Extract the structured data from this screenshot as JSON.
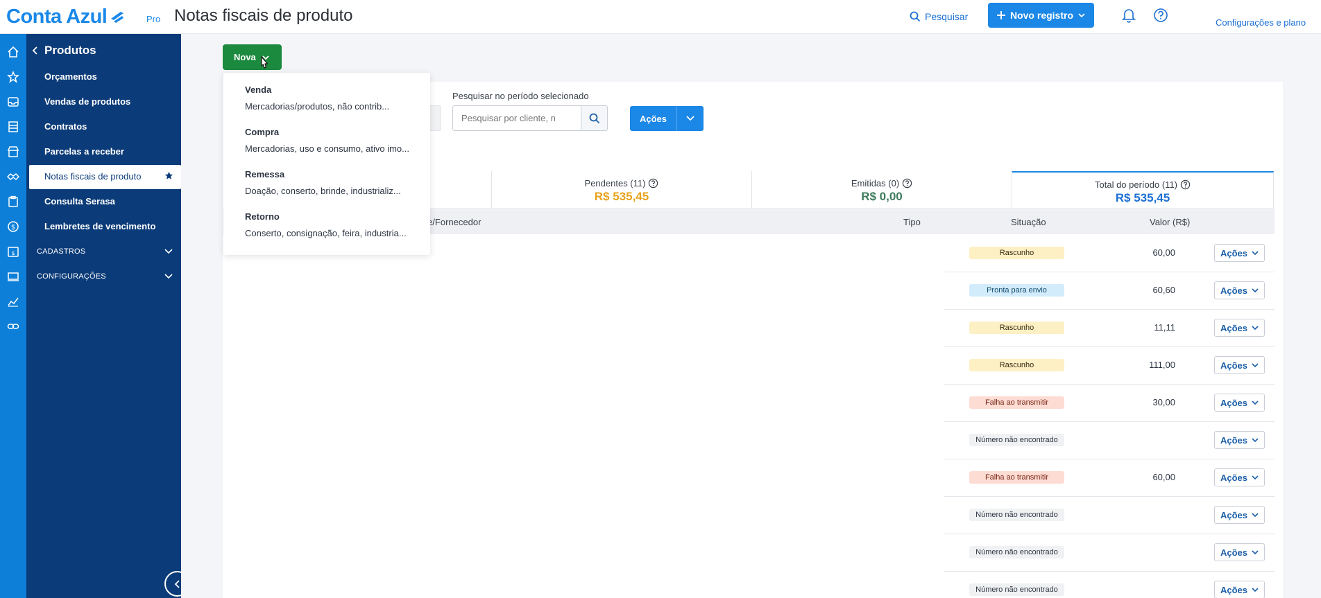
{
  "header": {
    "logo_text": "Conta Azul",
    "logo_badge": "Pro",
    "page_title": "Notas fiscais de produto",
    "search_label": "Pesquisar",
    "new_record_label": "Novo registro",
    "config_label": "Configurações e plano"
  },
  "sidebar": {
    "back_label": "Produtos",
    "items": [
      {
        "label": "Orçamentos"
      },
      {
        "label": "Vendas de produtos"
      },
      {
        "label": "Contratos"
      },
      {
        "label": "Parcelas a receber"
      },
      {
        "label": "Notas fiscais de produto",
        "active": true
      },
      {
        "label": "Consulta Serasa"
      },
      {
        "label": "Lembretes de vencimento"
      }
    ],
    "sections": [
      {
        "label": "CADASTROS"
      },
      {
        "label": "CONFIGURAÇÕES"
      }
    ]
  },
  "toolbar": {
    "nova_label": "Nova",
    "period_label": "Pesquisar no período selecionado",
    "search_placeholder": "Pesquisar por cliente, n",
    "acoes_label": "Ações"
  },
  "dropdown": {
    "items": [
      {
        "title": "Venda",
        "subtitle": "Mercadorias/produtos, não contrib..."
      },
      {
        "title": "Compra",
        "subtitle": "Mercadorias, uso e consumo, ativo imo..."
      },
      {
        "title": "Remessa",
        "subtitle": "Doação, conserto, brinde, industrializ..."
      },
      {
        "title": "Retorno",
        "subtitle": "Conserto, consignação, feira, industria..."
      }
    ]
  },
  "tabs": [
    {
      "label": "Pendentes (11)",
      "value": "R$ 535,45",
      "color": "#e8a21a"
    },
    {
      "label": "Emitidas (0)",
      "value": "R$ 0,00",
      "color": "#3e7b5c"
    },
    {
      "label": "Total do período (11)",
      "value": "R$ 535,45",
      "color": "#1b6fd4"
    }
  ],
  "table": {
    "headers": {
      "cliente": "ente/Fornecedor",
      "tipo": "Tipo",
      "situacao": "Situação",
      "valor": "Valor (R$)"
    },
    "rows": [
      {
        "status": "Rascunho",
        "kind": "rascunho",
        "value": "60,00",
        "action": "Ações"
      },
      {
        "status": "Pronta para envio",
        "kind": "pronta",
        "value": "60,60",
        "action": "Ações"
      },
      {
        "status": "Rascunho",
        "kind": "rascunho",
        "value": "11,11",
        "action": "Ações"
      },
      {
        "status": "Rascunho",
        "kind": "rascunho",
        "value": "111,00",
        "action": "Ações"
      },
      {
        "status": "Falha ao transmitir",
        "kind": "falha",
        "value": "30,00",
        "action": "Ações"
      },
      {
        "status": "Número não encontrado",
        "kind": "numero",
        "value": "",
        "action": "Ações"
      },
      {
        "status": "Falha ao transmitir",
        "kind": "falha",
        "value": "60,00",
        "action": "Ações"
      },
      {
        "status": "Número não encontrado",
        "kind": "numero",
        "value": "",
        "action": "Ações"
      },
      {
        "status": "Número não encontrado",
        "kind": "numero",
        "value": "",
        "action": "Ações"
      },
      {
        "status": "Número não encontrado",
        "kind": "numero",
        "value": "",
        "action": "Ações"
      }
    ]
  },
  "colors": {
    "brand": "#1a88e8",
    "sidebar": "#0b3b78",
    "rail": "#0d7fd8",
    "nova_button": "#1c8a3e"
  }
}
